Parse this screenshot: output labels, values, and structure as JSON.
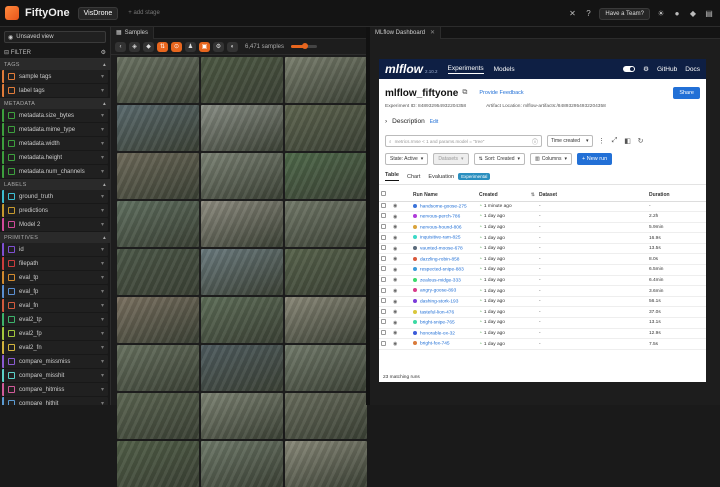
{
  "topbar": {
    "brand": "FiftyOne",
    "dataset": "VisDrone",
    "stage": "+ add stage",
    "team_button": "Have a Team?"
  },
  "sidebar": {
    "view": "Unsaved view",
    "filter_label": "FILTER",
    "groups": [
      {
        "label": "TAGS",
        "items": [
          {
            "label": "sample tags",
            "color": "#e07b39"
          },
          {
            "label": "label tags",
            "color": "#e07b39"
          }
        ]
      },
      {
        "label": "METADATA",
        "items": [
          {
            "label": "metadata.size_bytes",
            "color": "#3d9f3d"
          },
          {
            "label": "metadata.mime_type",
            "color": "#3d9f3d"
          },
          {
            "label": "metadata.width",
            "color": "#3d9f3d"
          },
          {
            "label": "metadata.height",
            "color": "#3d9f3d"
          },
          {
            "label": "metadata.num_channels",
            "color": "#3d9f3d"
          }
        ]
      },
      {
        "label": "LABELS",
        "items": [
          {
            "label": "ground_truth",
            "color": "#3dbdd1"
          },
          {
            "label": "predictions",
            "color": "#c79a2e"
          },
          {
            "label": "Model 2",
            "color": "#d14a9a"
          }
        ]
      },
      {
        "label": "PRIMITIVES",
        "items": [
          {
            "label": "id",
            "color": "#7e4fd1"
          },
          {
            "label": "filepath",
            "color": "#cc3d3d"
          },
          {
            "label": "eval_tp",
            "color": "#d18a2e"
          },
          {
            "label": "eval_fp",
            "color": "#5b8fd1"
          },
          {
            "label": "eval_fn",
            "color": "#d15b3d"
          },
          {
            "label": "eval2_tp",
            "color": "#3db36b"
          },
          {
            "label": "eval2_fp",
            "color": "#a3c73d"
          },
          {
            "label": "eval2_fn",
            "color": "#d1b33d"
          },
          {
            "label": "compare_missmiss",
            "color": "#8a5bd1"
          },
          {
            "label": "compare_misshit",
            "color": "#5bd1c7"
          },
          {
            "label": "compare_hitmiss",
            "color": "#d15b9a"
          },
          {
            "label": "compare_hithit",
            "color": "#5b9ad1"
          }
        ]
      }
    ]
  },
  "left_panel": {
    "tab": "Samples",
    "sample_count": "6,471 samples",
    "zoom_fraction": 0.55,
    "thumbs": [
      "#6b7363",
      "#4e5a44",
      "#7a7f6e",
      "#5a6a6e",
      "#8a8f86",
      "#5f6650",
      "#6e6a5a",
      "#7d8476",
      "#4f6a4a",
      "#607060",
      "#8e8c80",
      "#737a6a",
      "#4c5848",
      "#6a7a7e",
      "#58644c",
      "#7a7060",
      "#5e6e58",
      "#8a8878",
      "#687260",
      "#4f5c60",
      "#737c6c",
      "#5c6652",
      "#7e8474",
      "#6a6e5e",
      "#526048",
      "#6f7a6a",
      "#8a8a7a"
    ]
  },
  "right_panel": {
    "tab": "MLflow Dashboard",
    "mlflow": {
      "logo": "mlflow",
      "version": "2.10.2",
      "nav": [
        "Experiments",
        "Models"
      ],
      "nav_right": [
        "GitHub",
        "Docs"
      ],
      "experiment_title": "mlflow_fiftyone",
      "feedback": "Provide Feedback",
      "share": "Share",
      "experiment_id": "Experiment ID: 848932954932204358",
      "artifact_location": "Artifact Location: mlflow-artifacts:/848932954932204358",
      "description": "Description",
      "edit": "Edit",
      "search_placeholder": "metrics.rmse < 1 and params.model = \"tree\"",
      "time_created": "Time created",
      "state": "State: Active",
      "datasets": "Datasets",
      "sort": "Sort: Created",
      "columns": "Columns",
      "new_run": "+ New run",
      "view_tabs": [
        "Table",
        "Chart",
        "Evaluation"
      ],
      "experimental": "Experimental",
      "headers": [
        "Run Name",
        "Created",
        "Dataset",
        "Duration"
      ],
      "runs": [
        {
          "name": "handsome-goose-275",
          "created": "1 minute ago",
          "dataset": "-",
          "duration": "-",
          "color": "#3b73d9"
        },
        {
          "name": "nervous-perch-786",
          "created": "1 day ago",
          "dataset": "-",
          "duration": "2.2h",
          "color": "#b03bd9"
        },
        {
          "name": "nervous-hound-806",
          "created": "1 day ago",
          "dataset": "-",
          "duration": "5.9min",
          "color": "#d9a33b"
        },
        {
          "name": "inquisitive-ram-825",
          "created": "1 day ago",
          "dataset": "-",
          "duration": "16.9s",
          "color": "#3bd9c7"
        },
        {
          "name": "vaunted-moose-678",
          "created": "1 day ago",
          "dataset": "-",
          "duration": "13.5s",
          "color": "#5b6b7b"
        },
        {
          "name": "dazzling-robin-858",
          "created": "1 day ago",
          "dataset": "-",
          "duration": "8.0s",
          "color": "#d9593b"
        },
        {
          "name": "respected-snipe-883",
          "created": "1 day ago",
          "dataset": "-",
          "duration": "6.5min",
          "color": "#3b9bd9"
        },
        {
          "name": "zealous-midge-333",
          "created": "1 day ago",
          "dataset": "-",
          "duration": "6.4min",
          "color": "#3bd96b"
        },
        {
          "name": "angry-goose-893",
          "created": "1 day ago",
          "dataset": "-",
          "duration": "3.6min",
          "color": "#d93b8a"
        },
        {
          "name": "dashing-stork-193",
          "created": "1 day ago",
          "dataset": "-",
          "duration": "56.1s",
          "color": "#7b3bd9"
        },
        {
          "name": "tasteful-lion-476",
          "created": "1 day ago",
          "dataset": "-",
          "duration": "37.0s",
          "color": "#d9c73b"
        },
        {
          "name": "bright-snipe-765",
          "created": "1 day ago",
          "dataset": "-",
          "duration": "13.1s",
          "color": "#3bd9a3"
        },
        {
          "name": "honorable-ox-32",
          "created": "1 day ago",
          "dataset": "-",
          "duration": "12.9s",
          "color": "#3b5bd9"
        },
        {
          "name": "bright-fox-745",
          "created": "1 day ago",
          "dataset": "-",
          "duration": "7.5s",
          "color": "#d97b3b"
        }
      ],
      "matching": "23 matching runs"
    }
  }
}
